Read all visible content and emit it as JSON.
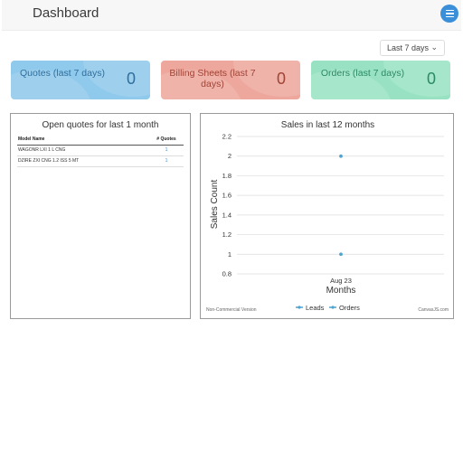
{
  "header": {
    "title": "Dashboard",
    "menu_icon": "hamburger-icon"
  },
  "filter": {
    "selected": "Last 7 days",
    "chevron": "⌄"
  },
  "cards": [
    {
      "label": "Quotes (last 7 days)",
      "value": "0",
      "color": "#8fc9ec"
    },
    {
      "label": "Billing Sheets (last 7 days)",
      "value": "0",
      "color": "#eda79c"
    },
    {
      "label": "Orders (last 7 days)",
      "value": "0",
      "color": "#98e2c3"
    }
  ],
  "quotes_panel": {
    "title": "Open quotes for last 1 month",
    "columns": [
      "Model Name",
      "# Quotes"
    ],
    "rows": [
      [
        "WAGONR LXI 1 L CNG",
        "1"
      ],
      [
        "DZIRE ZXI CNG 1.2 ISS 5 MT",
        "1"
      ]
    ]
  },
  "chart_data": {
    "type": "scatter",
    "title": "Sales in last 12 months",
    "xlabel": "Months",
    "ylabel": "Sales Count",
    "categories": [
      "Aug 23"
    ],
    "ylim": [
      0.8,
      2.2
    ],
    "yticks": [
      "2.2",
      "2",
      "1.8",
      "1.6",
      "1.4",
      "1.2",
      "1",
      "0.8"
    ],
    "grid": true,
    "legend": "bottom-center",
    "series": [
      {
        "name": "Leads",
        "values": [
          2
        ],
        "color": "#4fa3cf"
      },
      {
        "name": "Orders",
        "values": [
          1
        ],
        "color": "#4fa3cf"
      }
    ],
    "watermark_left": "Non-Commercial Version",
    "watermark_right": "CanvasJS.com"
  }
}
